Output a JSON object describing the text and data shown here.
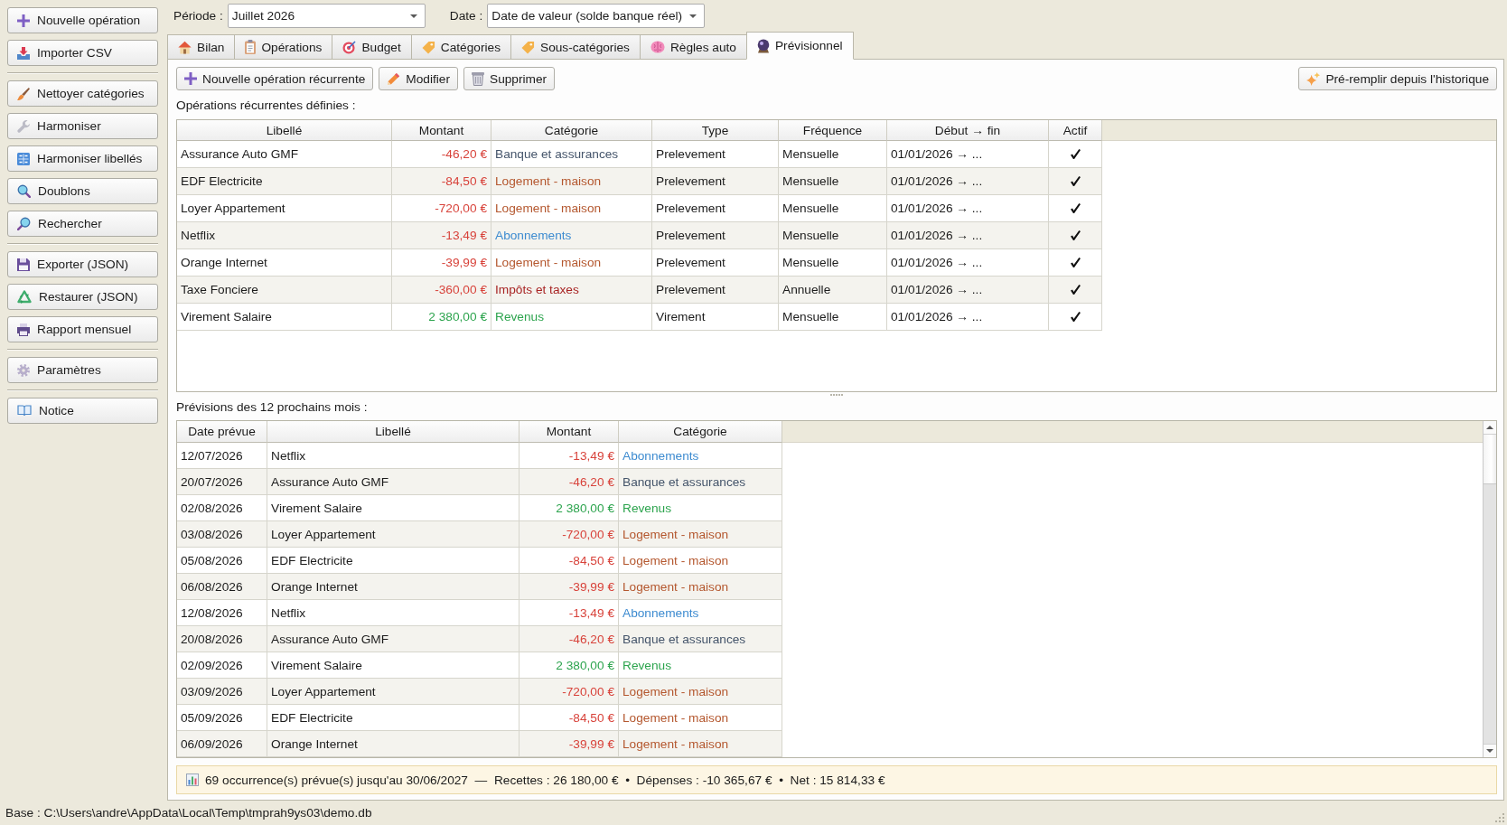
{
  "sidebar": {
    "groups": [
      [
        "Nouvelle opération",
        "Importer CSV"
      ],
      [
        "Nettoyer catégories",
        "Harmoniser",
        "Harmoniser libellés",
        "Doublons",
        "Rechercher"
      ],
      [
        "Exporter (JSON)",
        "Restaurer (JSON)",
        "Rapport mensuel"
      ],
      [
        "Paramètres"
      ],
      [
        "Notice"
      ]
    ]
  },
  "filters": [
    {
      "label": "Période :",
      "value": "Juillet 2026"
    },
    {
      "label": "Date :",
      "value": "Date de valeur (solde banque réel)"
    }
  ],
  "tabs": [
    {
      "label": "Bilan",
      "selected": false
    },
    {
      "label": "Opérations",
      "selected": false
    },
    {
      "label": "Budget",
      "selected": false
    },
    {
      "label": "Catégories",
      "selected": false
    },
    {
      "label": "Sous-catégories",
      "selected": false
    },
    {
      "label": "Règles auto",
      "selected": false
    },
    {
      "label": "Prévisionnel",
      "selected": true
    }
  ],
  "toolbar": {
    "buttons": [
      "Nouvelle opération récurrente",
      "Modifier",
      "Supprimer"
    ],
    "right_button": "Pré-remplir depuis l'historique"
  },
  "recurring": {
    "title": "Opérations récurrentes définies :",
    "columns": [
      "Libellé",
      "Montant",
      "Catégorie",
      "Type",
      "Fréquence",
      "Début → fin",
      "Actif"
    ],
    "rows": [
      {
        "label": "Assurance Auto GMF",
        "amount": {
          "text": "-46,20 €",
          "color": "#d8433b"
        },
        "category": {
          "text": "Banque et assurances",
          "color": "#44546a"
        },
        "type": "Prelevement",
        "frequency": "Mensuelle",
        "period": "01/01/2026 → ...",
        "active": true
      },
      {
        "label": "EDF Electricite",
        "amount": {
          "text": "-84,50 €",
          "color": "#d8433b"
        },
        "category": {
          "text": "Logement - maison",
          "color": "#b4572e"
        },
        "type": "Prelevement",
        "frequency": "Mensuelle",
        "period": "01/01/2026 → ...",
        "active": true
      },
      {
        "label": "Loyer Appartement",
        "amount": {
          "text": "-720,00 €",
          "color": "#d8433b"
        },
        "category": {
          "text": "Logement - maison",
          "color": "#b4572e"
        },
        "type": "Prelevement",
        "frequency": "Mensuelle",
        "period": "01/01/2026 → ...",
        "active": true
      },
      {
        "label": "Netflix",
        "amount": {
          "text": "-13,49 €",
          "color": "#d8433b"
        },
        "category": {
          "text": "Abonnements",
          "color": "#3d8bd0"
        },
        "type": "Prelevement",
        "frequency": "Mensuelle",
        "period": "01/01/2026 → ...",
        "active": true
      },
      {
        "label": "Orange Internet",
        "amount": {
          "text": "-39,99 €",
          "color": "#d8433b"
        },
        "category": {
          "text": "Logement - maison",
          "color": "#b4572e"
        },
        "type": "Prelevement",
        "frequency": "Mensuelle",
        "period": "01/01/2026 → ...",
        "active": true
      },
      {
        "label": "Taxe Fonciere",
        "amount": {
          "text": "-360,00 €",
          "color": "#d8433b"
        },
        "category": {
          "text": "Impôts et taxes",
          "color": "#a82424"
        },
        "type": "Prelevement",
        "frequency": "Annuelle",
        "period": "01/01/2026 → ...",
        "active": true
      },
      {
        "label": "Virement Salaire",
        "amount": {
          "text": "2 380,00 €",
          "color": "#2da44e"
        },
        "category": {
          "text": "Revenus",
          "color": "#2da44e"
        },
        "type": "Virement",
        "frequency": "Mensuelle",
        "period": "01/01/2026 → ...",
        "active": true
      }
    ]
  },
  "forecast": {
    "title": "Prévisions des 12 prochains mois :",
    "columns": [
      "Date prévue",
      "Libellé",
      "Montant",
      "Catégorie"
    ],
    "rows": [
      {
        "date": "12/07/2026",
        "label": "Netflix",
        "amount": {
          "text": "-13,49 €",
          "color": "#d8433b"
        },
        "category": {
          "text": "Abonnements",
          "color": "#3d8bd0"
        }
      },
      {
        "date": "20/07/2026",
        "label": "Assurance Auto GMF",
        "amount": {
          "text": "-46,20 €",
          "color": "#d8433b"
        },
        "category": {
          "text": "Banque et assurances",
          "color": "#44546a"
        }
      },
      {
        "date": "02/08/2026",
        "label": "Virement Salaire",
        "amount": {
          "text": "2 380,00 €",
          "color": "#2da44e"
        },
        "category": {
          "text": "Revenus",
          "color": "#2da44e"
        }
      },
      {
        "date": "03/08/2026",
        "label": "Loyer Appartement",
        "amount": {
          "text": "-720,00 €",
          "color": "#d8433b"
        },
        "category": {
          "text": "Logement - maison",
          "color": "#b4572e"
        }
      },
      {
        "date": "05/08/2026",
        "label": "EDF Electricite",
        "amount": {
          "text": "-84,50 €",
          "color": "#d8433b"
        },
        "category": {
          "text": "Logement - maison",
          "color": "#b4572e"
        }
      },
      {
        "date": "06/08/2026",
        "label": "Orange Internet",
        "amount": {
          "text": "-39,99 €",
          "color": "#d8433b"
        },
        "category": {
          "text": "Logement - maison",
          "color": "#b4572e"
        }
      },
      {
        "date": "12/08/2026",
        "label": "Netflix",
        "amount": {
          "text": "-13,49 €",
          "color": "#d8433b"
        },
        "category": {
          "text": "Abonnements",
          "color": "#3d8bd0"
        }
      },
      {
        "date": "20/08/2026",
        "label": "Assurance Auto GMF",
        "amount": {
          "text": "-46,20 €",
          "color": "#d8433b"
        },
        "category": {
          "text": "Banque et assurances",
          "color": "#44546a"
        }
      },
      {
        "date": "02/09/2026",
        "label": "Virement Salaire",
        "amount": {
          "text": "2 380,00 €",
          "color": "#2da44e"
        },
        "category": {
          "text": "Revenus",
          "color": "#2da44e"
        }
      },
      {
        "date": "03/09/2026",
        "label": "Loyer Appartement",
        "amount": {
          "text": "-720,00 €",
          "color": "#d8433b"
        },
        "category": {
          "text": "Logement - maison",
          "color": "#b4572e"
        }
      },
      {
        "date": "05/09/2026",
        "label": "EDF Electricite",
        "amount": {
          "text": "-84,50 €",
          "color": "#d8433b"
        },
        "category": {
          "text": "Logement - maison",
          "color": "#b4572e"
        }
      },
      {
        "date": "06/09/2026",
        "label": "Orange Internet",
        "amount": {
          "text": "-39,99 €",
          "color": "#d8433b"
        },
        "category": {
          "text": "Logement - maison",
          "color": "#b4572e"
        }
      }
    ]
  },
  "summary": "69 occurrence(s) prévue(s) jusqu'au 30/06/2027  —  Recettes : 26 180,00 €  •  Dépenses : -10 365,67 €  •  Net : 15 814,33 €",
  "status_bar": "Base : C:\\Users\\andre\\AppData\\Local\\Temp\\tmprah9ys03\\demo.db"
}
